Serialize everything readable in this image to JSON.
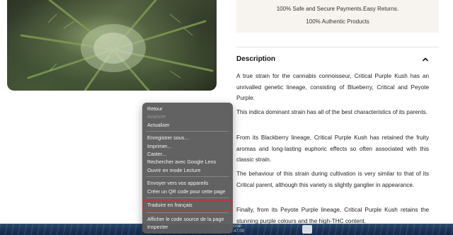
{
  "trust_box": {
    "line1": "100% Safe and Secure Payments.Easy Returns.",
    "line2": "100% Authentic Products"
  },
  "description": {
    "title": "Description",
    "paragraphs": [
      "A true strain for the cannabis connoisseur, Critical Purple Kush has an unrivalled genetic lineage, consisting of Blueberry, Critical and Peyote Purple.",
      "This indica dominant strain has all of the best characteristics of its parents.",
      "From its Blackberry lineage, Critical Purple Kush has retained the fruity aromas and long-lasting euphoric effects so often associated with this classic strain.",
      "The behaviour of this strain during cultivation is very similar to that of its Critical parent, although this variety is slightly ganglier in appearance.",
      "Finally, from its Peyote Purple lineage, Critical Purple Kush retains the stunning purple colours and the high-THC content."
    ]
  },
  "context_menu": {
    "groups": [
      [
        "Retour",
        "Avancer",
        "Actualiser"
      ],
      [
        "Enregistrer sous...",
        "Imprimer...",
        "Caster...",
        "Rechercher avec Google Lens",
        "Ouvrir en mode Lecture"
      ],
      [
        "Envoyer vers vos appareils",
        "Créer un QR code pour cette page"
      ],
      [
        "Traduire en français"
      ],
      [
        "Afficher le code source de la page",
        "Inspecter"
      ]
    ],
    "disabled_item": "Avancer",
    "highlighted_item": "Traduire en français"
  },
  "desktop": {
    "screenshot_label": "Capture d'écran",
    "screenshot_date": "2025-02...07.47.00"
  },
  "colors": {
    "highlight_border": "#e3262b",
    "menu_background": "#5c5c5c",
    "info_box_background": "#f7f3ee"
  }
}
